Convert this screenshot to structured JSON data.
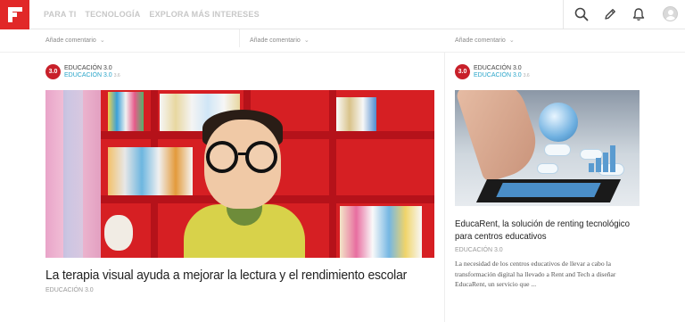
{
  "topbar": {
    "nav": [
      "PARA TI",
      "TECNOLOGÍA",
      "EXPLORA MÁS INTERESES"
    ],
    "icons": [
      "search-icon",
      "pencil-icon",
      "bell-icon",
      "user-avatar"
    ]
  },
  "comments": {
    "label": "Añade comentario",
    "chevron": "⌄"
  },
  "main_article": {
    "source_logo": "3.0",
    "source_name": "EDUCACIÓN 3.0",
    "source_sub": "EDUCACIÓN 3.0",
    "source_sub_small": "3.6",
    "headline": "La terapia visual ayuda a mejorar la lectura y el rendimiento escolar",
    "source_footer": "EDUCACIÓN 3.0"
  },
  "side_article": {
    "source_logo": "3.0",
    "source_name": "EDUCACIÓN 3.0",
    "source_sub": "EDUCACIÓN 3.0",
    "source_sub_small": "3.6",
    "headline": "EducaRent, la solución de renting tecnológico para centros educativos",
    "source_footer": "EDUCACIÓN 3.0",
    "excerpt": "La necesidad de los centros educativos de llevar a cabo la transformación digital ha llevado a Rent and Tech a diseñar EducaRent, un servicio que ..."
  },
  "colors": {
    "brand_red": "#e12828",
    "source_logo": "#c8202a",
    "link_blue": "#2aa5c9"
  }
}
